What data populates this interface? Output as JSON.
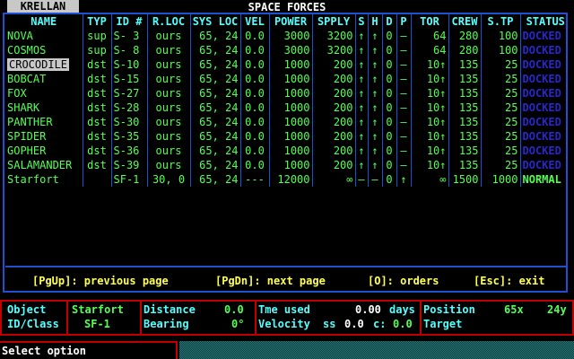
{
  "faction": "KRELLAN",
  "title": "SPACE FORCES",
  "columns": [
    "NAME",
    "TYP",
    "ID #",
    "R.LOC",
    "SYS LOC",
    "VEL",
    "POWER",
    "SPPLY",
    "S",
    "H",
    "D",
    "P",
    "TOR",
    "CREW",
    "S.TP",
    "STATUS"
  ],
  "ships": [
    {
      "name": "NOVA",
      "typ": "sup",
      "id": "S- 3",
      "rloc": "ours",
      "sysloc": "65, 24",
      "vel": "0.0",
      "power": "3000",
      "supply": "3200",
      "s": "↑",
      "h": "↑",
      "d": "0",
      "p": "–",
      "tor": "64",
      "crew": "280",
      "stp": "100",
      "status": "DOCKED"
    },
    {
      "name": "COSMOS",
      "typ": "sup",
      "id": "S- 8",
      "rloc": "ours",
      "sysloc": "65, 24",
      "vel": "0.0",
      "power": "3000",
      "supply": "3200",
      "s": "↑",
      "h": "↑",
      "d": "0",
      "p": "–",
      "tor": "64",
      "crew": "280",
      "stp": "100",
      "status": "DOCKED"
    },
    {
      "name": "CROCODILE",
      "typ": "dst",
      "id": "S-10",
      "rloc": "ours",
      "sysloc": "65, 24",
      "vel": "0.0",
      "power": "1000",
      "supply": "200",
      "s": "↑",
      "h": "↑",
      "d": "0",
      "p": "–",
      "tor": "10↑",
      "crew": "135",
      "stp": "25",
      "status": "DOCKED"
    },
    {
      "name": "BOBCAT",
      "typ": "dst",
      "id": "S-15",
      "rloc": "ours",
      "sysloc": "65, 24",
      "vel": "0.0",
      "power": "1000",
      "supply": "200",
      "s": "↑",
      "h": "↑",
      "d": "0",
      "p": "–",
      "tor": "10↑",
      "crew": "135",
      "stp": "25",
      "status": "DOCKED"
    },
    {
      "name": "FOX",
      "typ": "dst",
      "id": "S-27",
      "rloc": "ours",
      "sysloc": "65, 24",
      "vel": "0.0",
      "power": "1000",
      "supply": "200",
      "s": "↑",
      "h": "↑",
      "d": "0",
      "p": "–",
      "tor": "10↑",
      "crew": "135",
      "stp": "25",
      "status": "DOCKED"
    },
    {
      "name": "SHARK",
      "typ": "dst",
      "id": "S-28",
      "rloc": "ours",
      "sysloc": "65, 24",
      "vel": "0.0",
      "power": "1000",
      "supply": "200",
      "s": "↑",
      "h": "↑",
      "d": "0",
      "p": "–",
      "tor": "10↑",
      "crew": "135",
      "stp": "25",
      "status": "DOCKED"
    },
    {
      "name": "PANTHER",
      "typ": "dst",
      "id": "S-30",
      "rloc": "ours",
      "sysloc": "65, 24",
      "vel": "0.0",
      "power": "1000",
      "supply": "200",
      "s": "↑",
      "h": "↑",
      "d": "0",
      "p": "–",
      "tor": "10↑",
      "crew": "135",
      "stp": "25",
      "status": "DOCKED"
    },
    {
      "name": "SPIDER",
      "typ": "dst",
      "id": "S-35",
      "rloc": "ours",
      "sysloc": "65, 24",
      "vel": "0.0",
      "power": "1000",
      "supply": "200",
      "s": "↑",
      "h": "↑",
      "d": "0",
      "p": "–",
      "tor": "10↑",
      "crew": "135",
      "stp": "25",
      "status": "DOCKED"
    },
    {
      "name": "GOPHER",
      "typ": "dst",
      "id": "S-36",
      "rloc": "ours",
      "sysloc": "65, 24",
      "vel": "0.0",
      "power": "1000",
      "supply": "200",
      "s": "↑",
      "h": "↑",
      "d": "0",
      "p": "–",
      "tor": "10↑",
      "crew": "135",
      "stp": "25",
      "status": "DOCKED"
    },
    {
      "name": "SALAMANDER",
      "typ": "dst",
      "id": "S-39",
      "rloc": "ours",
      "sysloc": "65, 24",
      "vel": "0.0",
      "power": "1000",
      "supply": "200",
      "s": "↑",
      "h": "↑",
      "d": "0",
      "p": "–",
      "tor": "10↑",
      "crew": "135",
      "stp": "25",
      "status": "DOCKED"
    },
    {
      "name": "Starfort",
      "typ": "",
      "id": "SF-1",
      "rloc": "30, 0",
      "sysloc": "65, 24",
      "vel": "---",
      "power": "12000",
      "supply": "∞",
      "s": "–",
      "h": "–",
      "d": "0",
      "p": "↑",
      "tor": "∞",
      "crew": "1500",
      "stp": "1000",
      "status": "NORMAL"
    }
  ],
  "selected_index": 2,
  "hints": {
    "pgup": "[PgUp]: previous page",
    "pgdn": "[PgDn]: next page",
    "orders": "[O]: orders",
    "exit": "[Esc]: exit"
  },
  "info": {
    "object_label": "Object",
    "idclass_label": "ID/Class",
    "object_value": "Starfort",
    "idclass_value": "SF-1",
    "distance_label": "Distance",
    "distance_value": "0.0",
    "bearing_label": "Bearing",
    "bearing_value": "0°",
    "time_label": "Tme used",
    "time_value": "0.00",
    "time_unit": "days",
    "velocity_label": "Velocity",
    "velocity_ss_label": "ss",
    "velocity_ss_value": "0.0",
    "velocity_c_label": "c:",
    "velocity_c_value": "0.0",
    "position_label": "Position",
    "position_x": "65x",
    "position_y": "24y",
    "target_label": "Target"
  },
  "prompt": "Select option",
  "colors": {
    "frame": "#2050d0",
    "info_border": "#c00000",
    "docked": "#2828c8",
    "text_green": "#55ff55",
    "header_cyan": "#55ffff",
    "hint_yellow": "#ffff55"
  }
}
